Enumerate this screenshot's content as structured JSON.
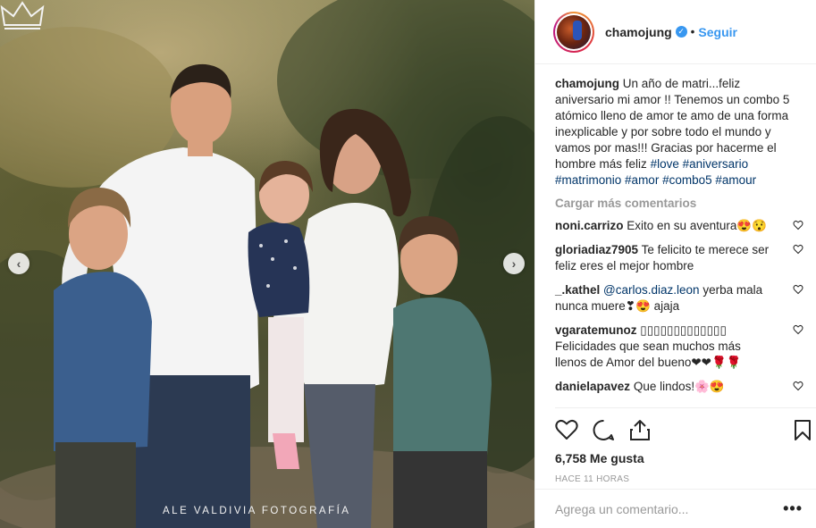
{
  "photo": {
    "watermark": "ALE VALDIVIA FOTOGRAFÍA",
    "prev_icon": "chevron-left-icon",
    "next_icon": "chevron-right-icon"
  },
  "header": {
    "username": "chamojung",
    "verified_icon": "verified-badge-icon",
    "separator": "•",
    "follow_label": "Seguir",
    "accent_color": "#3897f0"
  },
  "caption": {
    "username": "chamojung",
    "text": "Un año de matri...feliz aniversario mi amor !! Tenemos un combo 5 atómico lleno de amor te amo de una forma inexplicable y por sobre todo el mundo y vamos por mas!!! Gracias por hacerme el hombre más feliz",
    "hashtags": [
      "#love",
      "#aniversario",
      "#matrimonio",
      "#amor",
      "#combo5",
      "#amour"
    ]
  },
  "load_more_label": "Cargar más comentarios",
  "comments": [
    {
      "user": "noni.carrizo",
      "mention": "",
      "text": "Exito en su aventura😍😯"
    },
    {
      "user": "gloriadiaz7905",
      "mention": "",
      "text": "Te felicito te merece ser feliz eres el mejor hombre"
    },
    {
      "user": "_.kathel",
      "mention": "@carlos.diaz.leon",
      "text": "yerba mala nunca muere❣😍 ajaja"
    },
    {
      "user": "vgaratemunoz",
      "mention": "",
      "text": "▯▯▯▯▯▯▯▯▯▯▯▯▯ Felicidades que sean muchos más llenos de Amor del bueno❤❤🌹🌹"
    },
    {
      "user": "danielapavez",
      "mention": "",
      "text": "Que lindos!🌸😍"
    }
  ],
  "actions": {
    "like_icon": "heart-icon",
    "comment_icon": "comment-icon",
    "share_icon": "share-icon",
    "save_icon": "bookmark-icon",
    "likes_text": "6,758 Me gusta",
    "time_text": "HACE 11 HORAS"
  },
  "add_comment": {
    "placeholder": "Agrega un comentario...",
    "more_label": "•••"
  }
}
